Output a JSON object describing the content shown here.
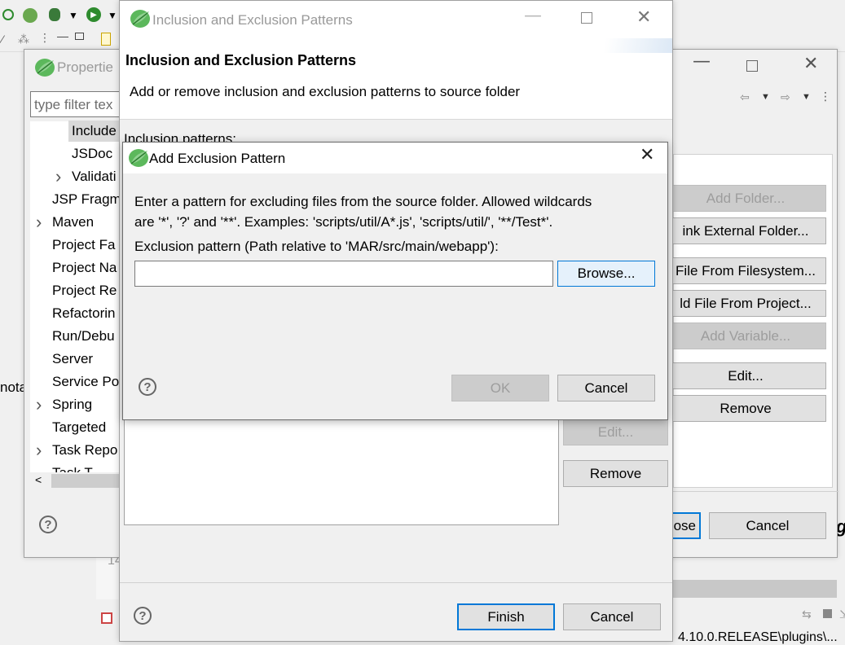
{
  "ide": {
    "status_text": "4.10.0.RELEASE\\plugins\\...",
    "side_text": "nota",
    "editor_line": "14",
    "far_right_char": "g"
  },
  "properties": {
    "title": "Propertie",
    "filter_placeholder": "type filter tex",
    "tree": [
      {
        "label": "Include",
        "indent": 2,
        "expander": false,
        "selected": true
      },
      {
        "label": "JSDoc",
        "indent": 2,
        "expander": false,
        "selected": false
      },
      {
        "label": "Validati",
        "indent": 2,
        "expander": true,
        "selected": false
      },
      {
        "label": "JSP Fragm",
        "indent": 1,
        "expander": false,
        "selected": false
      },
      {
        "label": "Maven",
        "indent": 1,
        "expander": true,
        "selected": false
      },
      {
        "label": "Project Fa",
        "indent": 1,
        "expander": false,
        "selected": false
      },
      {
        "label": "Project Na",
        "indent": 1,
        "expander": false,
        "selected": false
      },
      {
        "label": "Project Re",
        "indent": 1,
        "expander": false,
        "selected": false
      },
      {
        "label": "Refactorin",
        "indent": 1,
        "expander": false,
        "selected": false
      },
      {
        "label": "Run/Debu",
        "indent": 1,
        "expander": false,
        "selected": false
      },
      {
        "label": "Server",
        "indent": 1,
        "expander": false,
        "selected": false
      },
      {
        "label": "Service Po",
        "indent": 1,
        "expander": false,
        "selected": false
      },
      {
        "label": "Spring",
        "indent": 1,
        "expander": true,
        "selected": false
      },
      {
        "label": "Targeted",
        "indent": 1,
        "expander": false,
        "selected": false
      },
      {
        "label": "Task Repo",
        "indent": 1,
        "expander": true,
        "selected": false
      },
      {
        "label": "Task T",
        "indent": 1,
        "expander": false,
        "selected": false
      }
    ],
    "buttons": {
      "add_folder": "Add Folder...",
      "link_external": "ink External Folder...",
      "file_from_fs": "File From Filesystem...",
      "file_from_project": "ld File From Project...",
      "add_variable": "Add Variable...",
      "edit": "Edit...",
      "remove": "Remove",
      "close": "ose",
      "cancel": "Cancel"
    }
  },
  "patterns_dialog": {
    "title": "Inclusion and Exclusion Patterns",
    "heading": "Inclusion and Exclusion Patterns",
    "description": "Add or remove inclusion and exclusion patterns to source folder",
    "inclusion_label": "Inclusion patterns:",
    "edit": "Edit...",
    "remove": "Remove",
    "finish": "Finish",
    "cancel": "Cancel"
  },
  "exclusion_dialog": {
    "title": "Add Exclusion Pattern",
    "message_line1": "Enter a pattern for excluding files from the source folder. Allowed wildcards",
    "message_line2": "are '*', '?' and '**'. Examples: 'scripts/util/A*.js', 'scripts/util/', '**/Test*'.",
    "field_label": "Exclusion pattern (Path relative to 'MAR/src/main/webapp'):",
    "pattern_value": "",
    "browse": "Browse...",
    "ok": "OK",
    "cancel": "Cancel"
  },
  "icons": {
    "leaf_color": "#5cb85c",
    "help": "?"
  },
  "colors": {
    "focus_blue": "#0078d7",
    "selection": "#d9d9d9"
  }
}
